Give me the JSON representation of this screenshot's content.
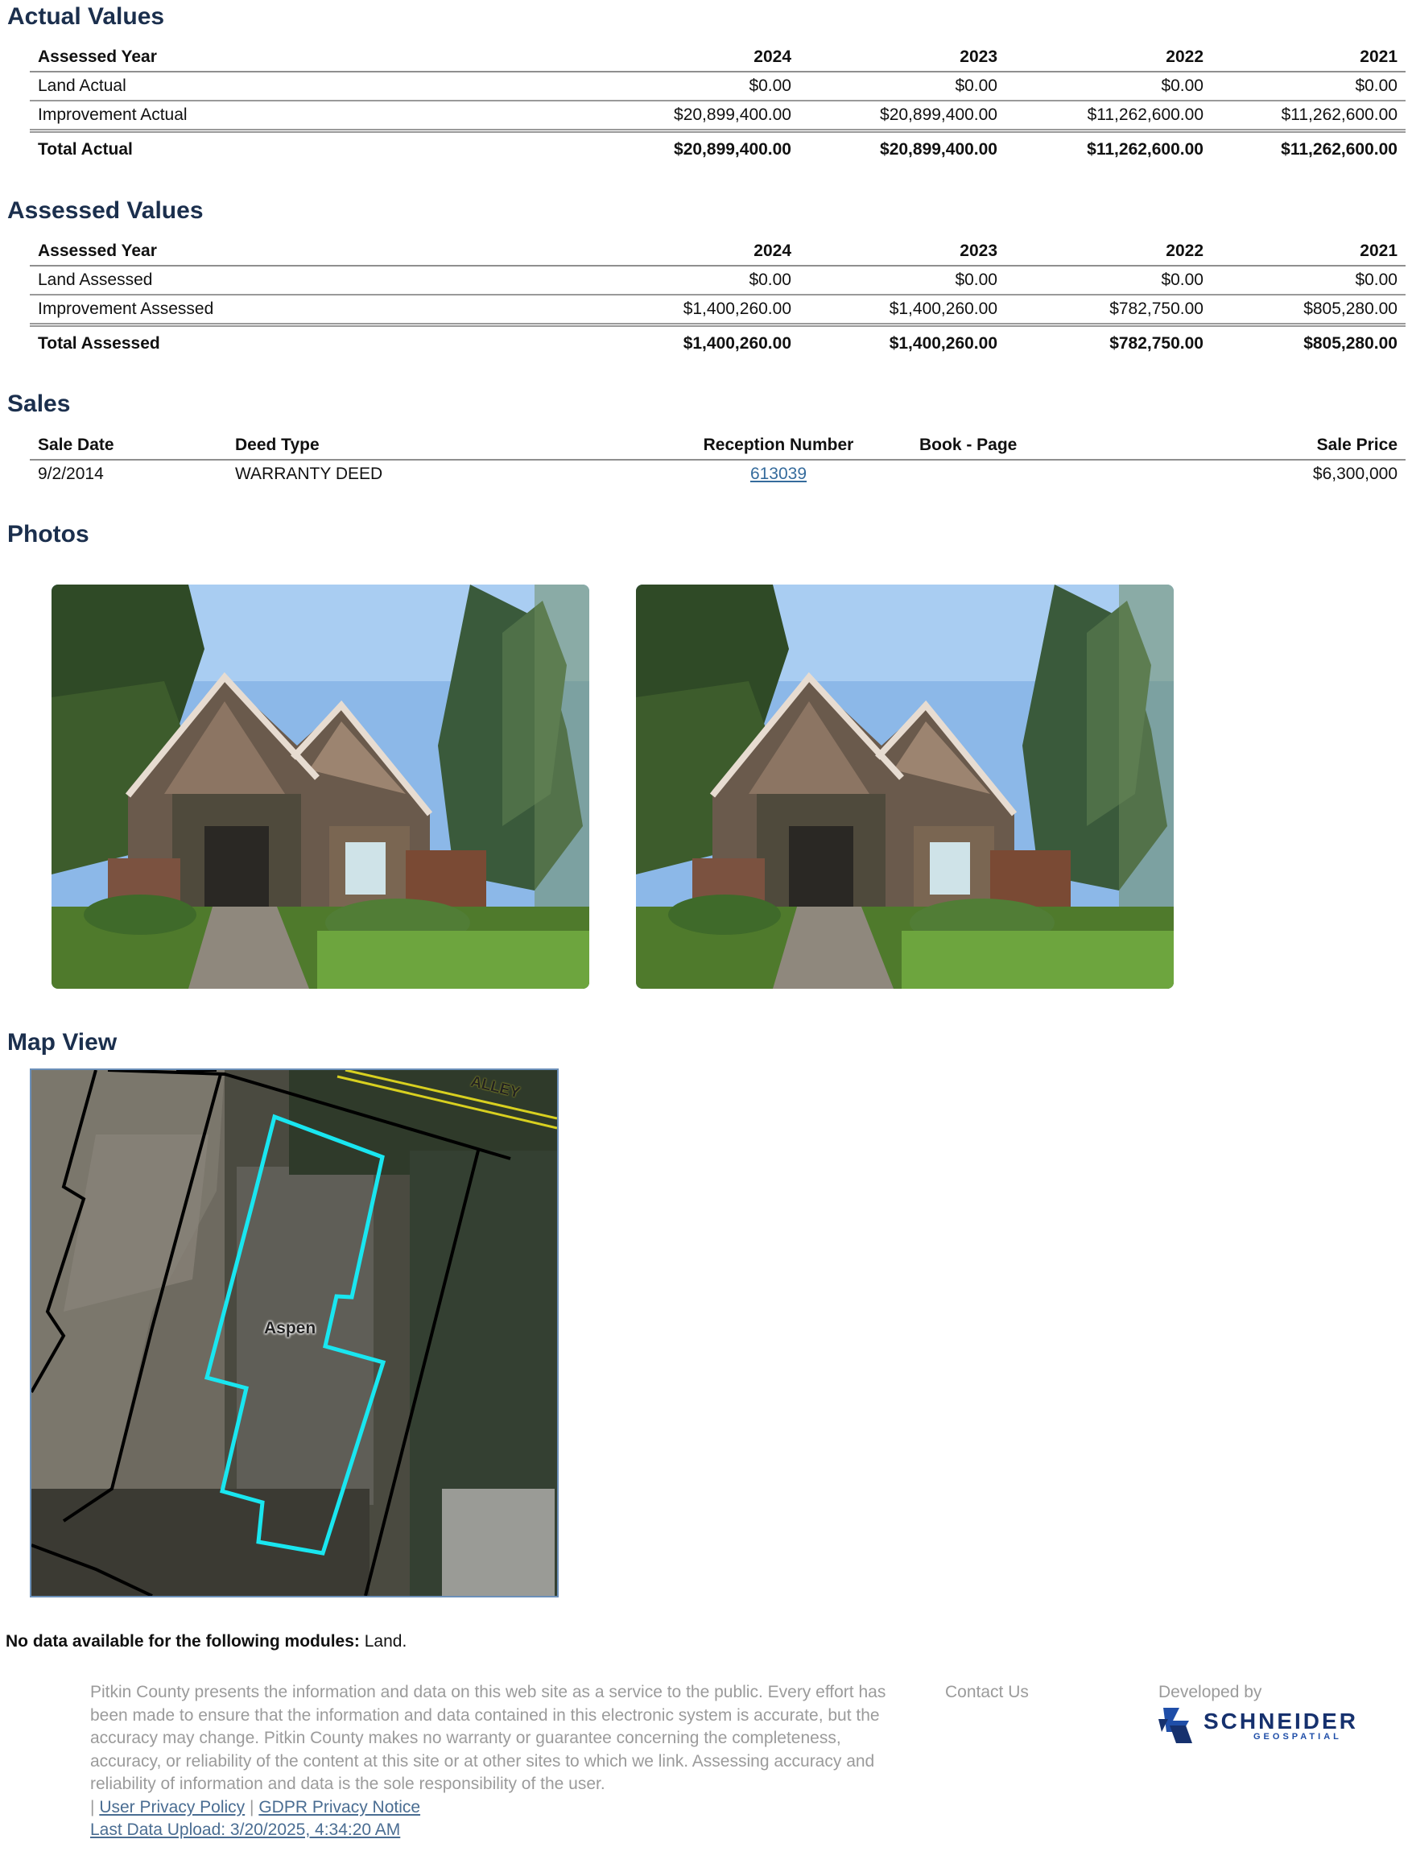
{
  "actual": {
    "title": "Actual Values",
    "headers": [
      "Assessed Year",
      "2024",
      "2023",
      "2022",
      "2021"
    ],
    "rows": [
      [
        "Land Actual",
        "$0.00",
        "$0.00",
        "$0.00",
        "$0.00"
      ],
      [
        "Improvement Actual",
        "$20,899,400.00",
        "$20,899,400.00",
        "$11,262,600.00",
        "$11,262,600.00"
      ]
    ],
    "total": [
      "Total Actual",
      "$20,899,400.00",
      "$20,899,400.00",
      "$11,262,600.00",
      "$11,262,600.00"
    ]
  },
  "assessed": {
    "title": "Assessed Values",
    "headers": [
      "Assessed Year",
      "2024",
      "2023",
      "2022",
      "2021"
    ],
    "rows": [
      [
        "Land Assessed",
        "$0.00",
        "$0.00",
        "$0.00",
        "$0.00"
      ],
      [
        "Improvement Assessed",
        "$1,400,260.00",
        "$1,400,260.00",
        "$782,750.00",
        "$805,280.00"
      ]
    ],
    "total": [
      "Total Assessed",
      "$1,400,260.00",
      "$1,400,260.00",
      "$782,750.00",
      "$805,280.00"
    ]
  },
  "sales": {
    "title": "Sales",
    "headers": [
      "Sale Date",
      "Deed Type",
      "Reception Number",
      "Book - Page",
      "Sale Price"
    ],
    "rows": [
      [
        "9/2/2014",
        "WARRANTY DEED",
        "613039",
        "",
        "$6,300,000"
      ]
    ]
  },
  "photos": {
    "title": "Photos"
  },
  "map": {
    "title": "Map View",
    "label_alley": "ALLEY",
    "label_place": "Aspen"
  },
  "nodata": {
    "label": "No data available for the following modules:",
    "modules": "Land."
  },
  "footer": {
    "disclaimer": "Pitkin County presents the information and data on this web site as a service to the public. Every effort has been made to ensure that the information and data contained in this electronic system is accurate, but the accuracy may change. Pitkin County makes no warranty or guarantee concerning the completeness, accuracy, or reliability of the content at this site or at other sites to which we link. Assessing accuracy and reliability of information and data is the sole responsibility of the user.",
    "sep": "|",
    "privacy": "User Privacy Policy",
    "gdpr": "GDPR Privacy Notice",
    "upload": "Last Data Upload: 3/20/2025, 4:34:20 AM",
    "contact": "Contact Us",
    "developed_by": "Developed by",
    "brand_name": "SCHNEIDER",
    "brand_sub": "GEOSPATIAL"
  },
  "colors": {
    "heading": "#1b2f4d",
    "link": "#356b9c",
    "parcel": "#19e6f0",
    "brand": "#1f4ea8"
  }
}
